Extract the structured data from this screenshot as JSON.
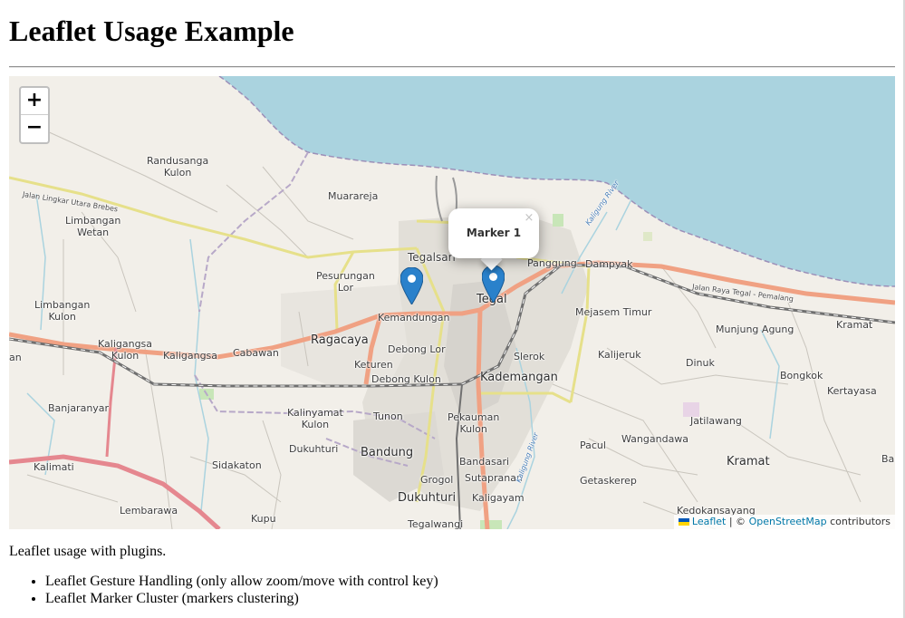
{
  "page": {
    "title": "Leaflet Usage Example",
    "description": "Leaflet usage with plugins.",
    "plugins": [
      "Leaflet Gesture Handling (only allow zoom/move with control key)",
      "Leaflet Marker Cluster (markers clustering)"
    ]
  },
  "map": {
    "zoom_in_label": "+",
    "zoom_out_label": "−",
    "popup": {
      "text": "Marker 1",
      "close_label": "×"
    },
    "markers": [
      "marker-1",
      "marker-2"
    ],
    "marker_color": "#2a81cb",
    "sea_color": "#aad3df",
    "land_color": "#f2efe9",
    "labels": {
      "randusanga_kulon": "Randusanga\nKulon",
      "muarareja": "Muarareja",
      "limbangan_wetan": "Limbangan\nWetan",
      "jalan_lingkar": "Jalan Lingkar Utara Brebes",
      "tegalsari": "Tegalsari",
      "panggung": "Panggung",
      "dampyak": "Dampyak",
      "pesurungan_lor": "Pesurungan\nLor",
      "tegal": "Tegal",
      "kemandungan": "Kemandungan",
      "limbangan_kulon": "Limbangan\nKulon",
      "ragacaya": "Ragacaya",
      "mejasem_timur": "Mejasem Timur",
      "jalan_raya": "Jalan Raya Tegal - Pemalang",
      "munjung_agung": "Munjung Agung",
      "kramat_top": "Kramat",
      "kaligangsa_kulon": "Kaligangsa\nKulon",
      "kaligangsa": "Kaligangsa",
      "cabawan": "Cabawan",
      "debong_lor": "Debong Lor",
      "keturen": "Keturen",
      "slerok": "Slerok",
      "kalijeruk": "Kalijeruk",
      "dinuk": "Dinuk",
      "bongkok": "Bongkok",
      "debong_kulon": "Debong Kulon",
      "kademangan": "Kademangan",
      "kertayasa": "Kertayasa",
      "banjaranyar": "Banjaranyar",
      "kalinyamat_kulon": "Kalinyamat\nKulon",
      "tunon": "Tunon",
      "pekauman_kulon": "Pekauman\nKulon",
      "jatilawang": "Jatilawang",
      "wangandawa": "Wangandawa",
      "dukuhturi_small": "Dukuhturi",
      "bandung": "Bandung",
      "pacul": "Pacul",
      "bandasari": "Bandasari",
      "kramat_big": "Kramat",
      "ba": "Ba",
      "kalimati": "Kalimati",
      "sidakaton": "Sidakaton",
      "grogol": "Grogol",
      "sutapranan": "Sutapranan",
      "getaskerep": "Getaskerep",
      "dukuhturi_big": "Dukuhturi",
      "kaligayam": "Kaligayam",
      "lembarawa": "Lembarawa",
      "kupu": "Kupu",
      "tegalwangi": "Tegalwangi",
      "kedokansayang": "Kedokansayang",
      "an": "an",
      "kaligung_river": "Kaligung River",
      "kaligung_river2": "Kaligung River"
    },
    "attribution": {
      "leaflet_label": "Leaflet",
      "separator": "| ©",
      "osm_label": "OpenStreetMap",
      "suffix": "contributors"
    }
  }
}
